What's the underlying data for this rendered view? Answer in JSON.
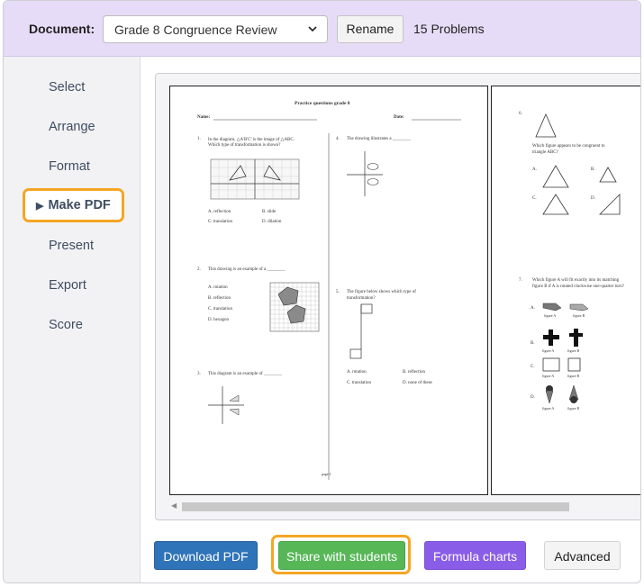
{
  "toolbar": {
    "document_label": "Document:",
    "document_value": "Grade 8 Congruence Review",
    "rename_label": "Rename",
    "problems_count": "15 Problems"
  },
  "sidebar": {
    "items": [
      {
        "label": "Select"
      },
      {
        "label": "Arrange"
      },
      {
        "label": "Format"
      },
      {
        "label": "Make PDF"
      },
      {
        "label": "Present"
      },
      {
        "label": "Export"
      },
      {
        "label": "Score"
      }
    ],
    "active_marker": "▶"
  },
  "preview": {
    "page1": {
      "title": "Practice questions grade 8",
      "name_label": "Name:",
      "date_label": "Date:",
      "q1_num": "1.",
      "q1_text_a": "In the diagram, △A'B'C' is the image of △ABC.",
      "q1_text_b": "Which type of transformation is shown?",
      "q1_a": "A.  reflection",
      "q1_b": "B.  slide",
      "q1_c": "C.  translation",
      "q1_d": "D.  dilation",
      "q2_num": "2.",
      "q2_text": "This drawing is an example of a ________",
      "q2_a": "A.  rotation",
      "q2_b": "B.  reflection",
      "q2_c": "C.  translation",
      "q2_d": "D.  hexagon",
      "q3_num": "3.",
      "q3_text": "This diagram is an example of ________",
      "q4_num": "4.",
      "q4_text": "The drawing illustrates a ________",
      "q5_num": "5.",
      "q5_text_a": "The figure below shows which type of",
      "q5_text_b": "transformation?",
      "q5_a": "A.  rotation",
      "q5_b": "B.  reflection",
      "q5_c": "C.  translation",
      "q5_d": "D.  none of these",
      "footer": "page 1"
    },
    "page2": {
      "q6_num": "6.",
      "q6_text_a": "Which figure appears to be congruent to",
      "q6_text_b": "triangle ABC?",
      "q6_labels": [
        "A.",
        "B.",
        "C.",
        "D."
      ],
      "q7_num": "7.",
      "q7_text_a": "Which figure A will fit exactly into its matching",
      "q7_text_b": "figure B if A is rotated clockwise one-quarter turn?",
      "q7_options": [
        "A.",
        "B.",
        "C.",
        "D."
      ],
      "fig_a": "figure A",
      "fig_b": "figure B"
    }
  },
  "footer": {
    "download_label": "Download PDF",
    "share_label": "Share with students",
    "formula_label": "Formula charts",
    "advanced_label": "Advanced"
  },
  "colors": {
    "topbar": "#e6dcf7",
    "highlight": "#f5a623",
    "download": "#2f73b8",
    "share": "#57b757",
    "formula": "#8a5de8"
  }
}
